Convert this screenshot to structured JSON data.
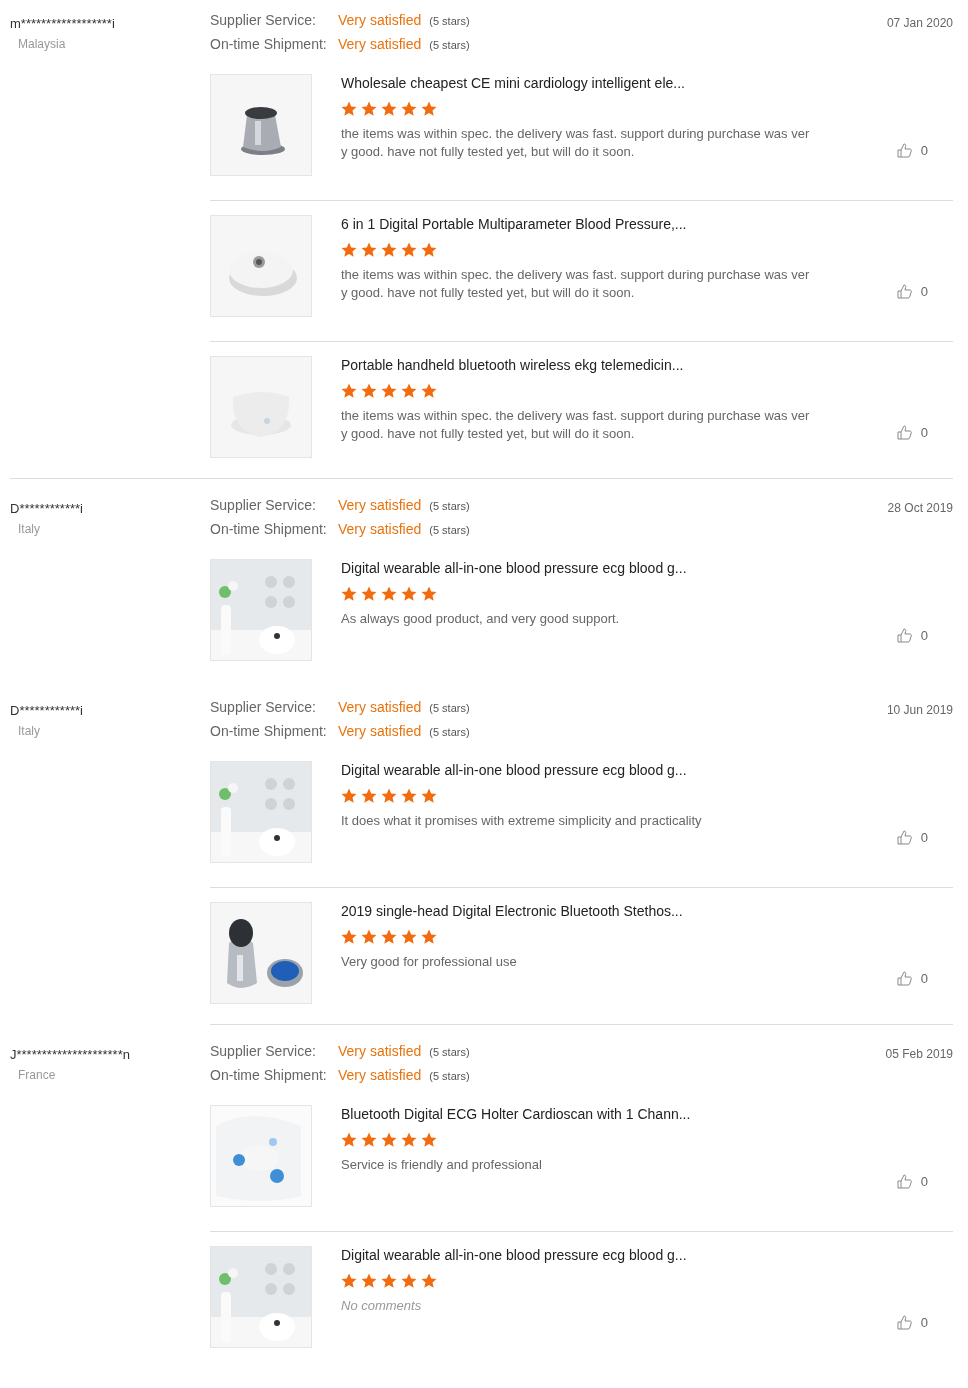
{
  "reviews": [
    {
      "reviewer": "m******************i",
      "country": "Malaysia",
      "date": "07 Jan 2020",
      "divider_below": true,
      "divider_full_width": true,
      "ratings": [
        {
          "label": "Supplier Service:",
          "verdict": "Very satisfied",
          "stars_text": "(5 stars)"
        },
        {
          "label": "On-time Shipment:",
          "verdict": "Very satisfied",
          "stars_text": "(5 stars)"
        }
      ],
      "items": [
        {
          "title": "Wholesale cheapest CE mini cardiology intelligent ele...",
          "stars": 5,
          "comment": "the items was within spec. the delivery was fast. support during purchase was very good. have not fully tested yet, but will do it soon.",
          "no_comment": false,
          "likes": "0"
        },
        {
          "title": "6 in 1 Digital Portable Multiparameter Blood Pressure,...",
          "stars": 5,
          "comment": "the items was within spec. the delivery was fast. support during purchase was very good. have not fully tested yet, but will do it soon.",
          "no_comment": false,
          "likes": "0"
        },
        {
          "title": "Portable handheld bluetooth wireless ekg telemedicin...",
          "stars": 5,
          "comment": "the items was within spec. the delivery was fast. support during purchase was very good. have not fully tested yet, but will do it soon.",
          "no_comment": false,
          "likes": "0"
        }
      ]
    },
    {
      "reviewer": "D************i",
      "country": "Italy",
      "date": "28 Oct 2019",
      "ratings": [
        {
          "label": "Supplier Service:",
          "verdict": "Very satisfied",
          "stars_text": "(5 stars)"
        },
        {
          "label": "On-time Shipment:",
          "verdict": "Very satisfied",
          "stars_text": "(5 stars)"
        }
      ],
      "items": [
        {
          "title": "Digital wearable all-in-one blood pressure ecg blood g...",
          "stars": 5,
          "comment": "As always good product, and very good support.",
          "no_comment": false,
          "likes": "0"
        }
      ]
    },
    {
      "reviewer": "D************i",
      "country": "Italy",
      "date": "10 Jun 2019",
      "divider_below": true,
      "divider_full_width": false,
      "ratings": [
        {
          "label": "Supplier Service:",
          "verdict": "Very satisfied",
          "stars_text": "(5 stars)"
        },
        {
          "label": "On-time Shipment:",
          "verdict": "Very satisfied",
          "stars_text": "(5 stars)"
        }
      ],
      "items": [
        {
          "title": "Digital wearable all-in-one blood pressure ecg blood g...",
          "stars": 5,
          "comment": "It does what it promises with extreme simplicity and practicality",
          "no_comment": false,
          "likes": "0"
        },
        {
          "title": "2019 single-head Digital Electronic Bluetooth Stethos...",
          "stars": 5,
          "comment": "Very good for professional use",
          "no_comment": false,
          "likes": "0"
        }
      ]
    },
    {
      "reviewer": "J*********************n",
      "country": "France",
      "date": "05 Feb 2019",
      "ratings": [
        {
          "label": "Supplier Service:",
          "verdict": "Very satisfied",
          "stars_text": "(5 stars)"
        },
        {
          "label": "On-time Shipment:",
          "verdict": "Very satisfied",
          "stars_text": "(5 stars)"
        }
      ],
      "items": [
        {
          "title": "Bluetooth Digital ECG Holter Cardioscan with 1 Chann...",
          "stars": 5,
          "comment": "Service is friendly and professional",
          "no_comment": false,
          "likes": "0"
        },
        {
          "title": "Digital wearable all-in-one blood pressure ecg blood g...",
          "stars": 5,
          "comment": "No comments",
          "no_comment": true,
          "likes": "0"
        }
      ]
    }
  ]
}
